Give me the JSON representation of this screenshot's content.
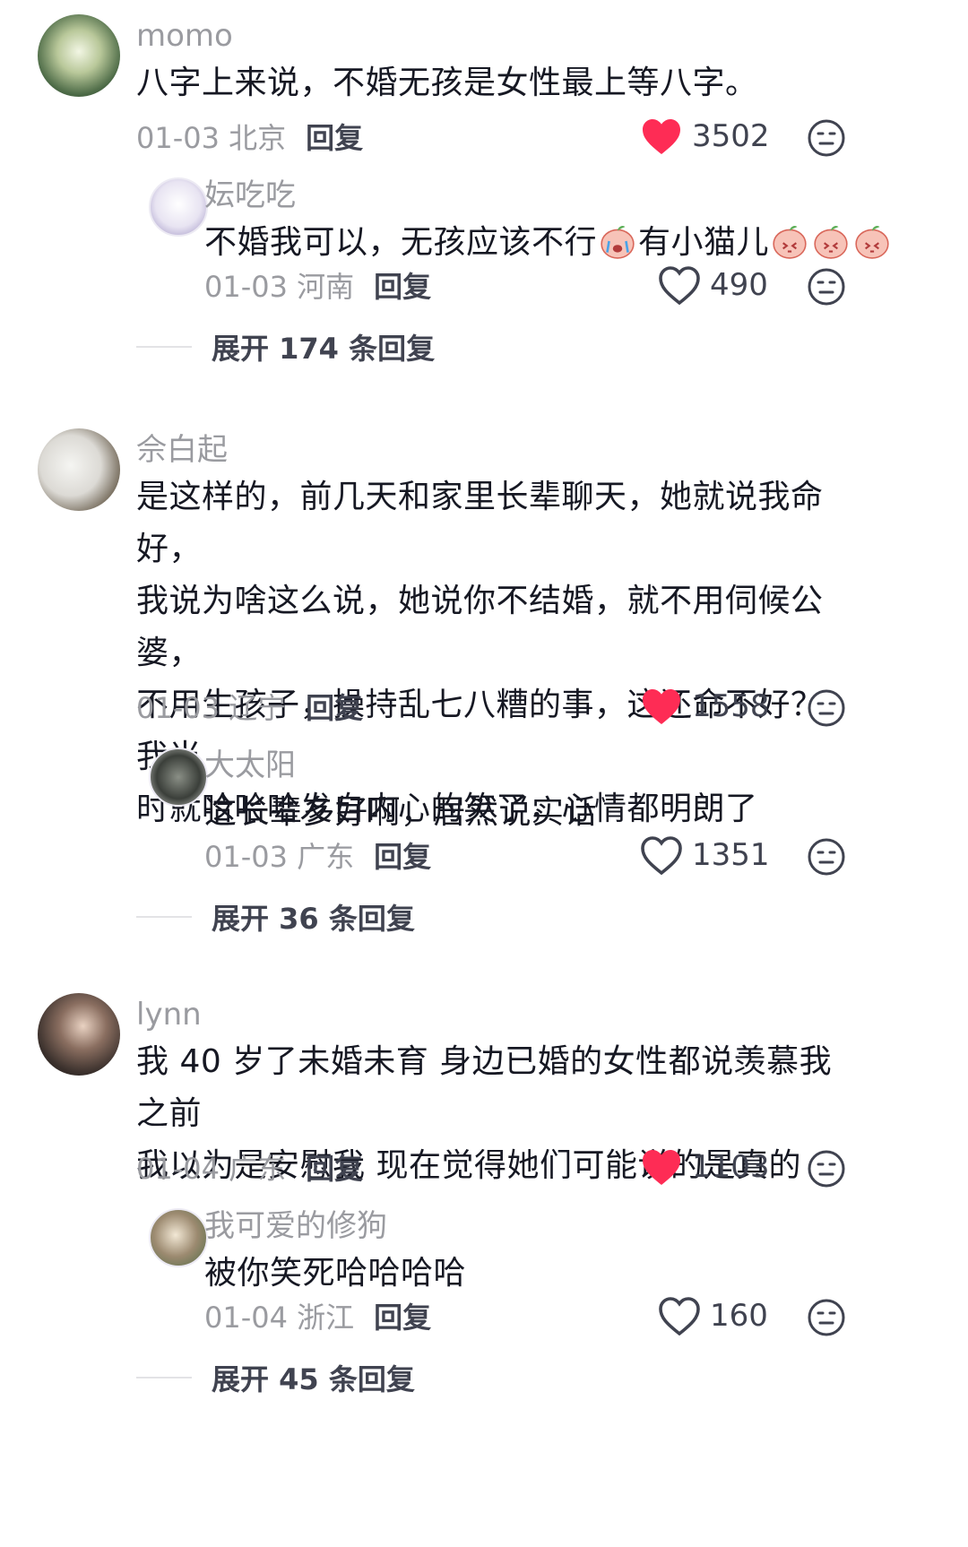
{
  "reply_label": "回复",
  "threads": [
    {
      "user": "momo",
      "text_lines": [
        "八字上来说，不婚无孩是女性最上等八字。"
      ],
      "date": "01-03",
      "location": "北京",
      "likes": "3502",
      "liked": true,
      "reply": {
        "user": "妘吃吃",
        "text_before": "不婚我可以，无孩应该不行",
        "text_after": "有小猫儿",
        "emoji_before": [
          "crying-face-emoji"
        ],
        "emoji_after": [
          "peach-emoji",
          "peach-emoji",
          "peach-emoji"
        ],
        "date": "01-03",
        "location": "河南",
        "likes": "490",
        "liked": false
      },
      "expand_label": "展开 174 条回复"
    },
    {
      "user": "佘白起",
      "text_lines": [
        "是这样的，前几天和家里长辈聊天，她就说我命好，",
        "我说为啥这么说，她说你不结婚，就不用伺候公婆，",
        "不用生孩子，操持乱七八糟的事，这还命不好？我当",
        "时就哈哈哈发自内心的笑了，心情都明朗了"
      ],
      "date": "01-03",
      "location": "辽宁",
      "likes": "1558",
      "liked": true,
      "reply": {
        "user": "大太阳",
        "text_before": "这长辈多好啊，居然说实话",
        "text_after": "",
        "emoji_before": [],
        "emoji_after": [],
        "date": "01-03",
        "location": "广东",
        "likes": "1351",
        "liked": false
      },
      "expand_label": "展开 36 条回复"
    },
    {
      "user": "lynn",
      "text_lines": [
        "我 40 岁了未婚未育 身边已婚的女性都说羡慕我 之前",
        "我以为是安慰我 现在觉得她们可能说的是真的"
      ],
      "date": "01-04",
      "location": "广东",
      "likes": "1103",
      "liked": true,
      "reply": {
        "user": "我可爱的修狗",
        "text_before": "被你笑死哈哈哈哈",
        "text_after": "",
        "emoji_before": [],
        "emoji_after": [],
        "date": "01-04",
        "location": "浙江",
        "likes": "160",
        "liked": false
      },
      "expand_label": "展开 45 条回复"
    }
  ],
  "colors": {
    "like_red": "#fe2c55",
    "text": "#161823",
    "muted": "#9a9ba0"
  }
}
